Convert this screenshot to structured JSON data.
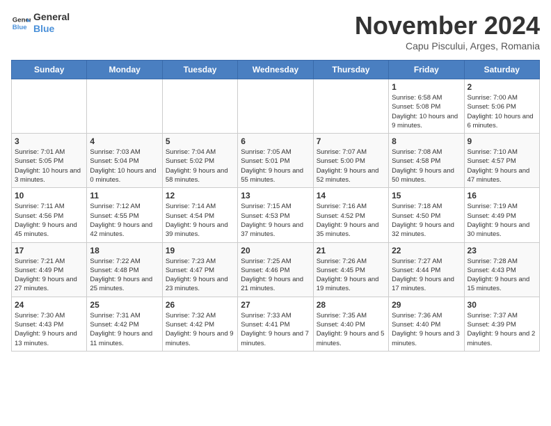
{
  "logo": {
    "line1": "General",
    "line2": "Blue"
  },
  "title": "November 2024",
  "subtitle": "Capu Piscului, Arges, Romania",
  "days_of_week": [
    "Sunday",
    "Monday",
    "Tuesday",
    "Wednesday",
    "Thursday",
    "Friday",
    "Saturday"
  ],
  "weeks": [
    [
      {
        "date": "",
        "info": ""
      },
      {
        "date": "",
        "info": ""
      },
      {
        "date": "",
        "info": ""
      },
      {
        "date": "",
        "info": ""
      },
      {
        "date": "",
        "info": ""
      },
      {
        "date": "1",
        "info": "Sunrise: 6:58 AM\nSunset: 5:08 PM\nDaylight: 10 hours and 9 minutes."
      },
      {
        "date": "2",
        "info": "Sunrise: 7:00 AM\nSunset: 5:06 PM\nDaylight: 10 hours and 6 minutes."
      }
    ],
    [
      {
        "date": "3",
        "info": "Sunrise: 7:01 AM\nSunset: 5:05 PM\nDaylight: 10 hours and 3 minutes."
      },
      {
        "date": "4",
        "info": "Sunrise: 7:03 AM\nSunset: 5:04 PM\nDaylight: 10 hours and 0 minutes."
      },
      {
        "date": "5",
        "info": "Sunrise: 7:04 AM\nSunset: 5:02 PM\nDaylight: 9 hours and 58 minutes."
      },
      {
        "date": "6",
        "info": "Sunrise: 7:05 AM\nSunset: 5:01 PM\nDaylight: 9 hours and 55 minutes."
      },
      {
        "date": "7",
        "info": "Sunrise: 7:07 AM\nSunset: 5:00 PM\nDaylight: 9 hours and 52 minutes."
      },
      {
        "date": "8",
        "info": "Sunrise: 7:08 AM\nSunset: 4:58 PM\nDaylight: 9 hours and 50 minutes."
      },
      {
        "date": "9",
        "info": "Sunrise: 7:10 AM\nSunset: 4:57 PM\nDaylight: 9 hours and 47 minutes."
      }
    ],
    [
      {
        "date": "10",
        "info": "Sunrise: 7:11 AM\nSunset: 4:56 PM\nDaylight: 9 hours and 45 minutes."
      },
      {
        "date": "11",
        "info": "Sunrise: 7:12 AM\nSunset: 4:55 PM\nDaylight: 9 hours and 42 minutes."
      },
      {
        "date": "12",
        "info": "Sunrise: 7:14 AM\nSunset: 4:54 PM\nDaylight: 9 hours and 39 minutes."
      },
      {
        "date": "13",
        "info": "Sunrise: 7:15 AM\nSunset: 4:53 PM\nDaylight: 9 hours and 37 minutes."
      },
      {
        "date": "14",
        "info": "Sunrise: 7:16 AM\nSunset: 4:52 PM\nDaylight: 9 hours and 35 minutes."
      },
      {
        "date": "15",
        "info": "Sunrise: 7:18 AM\nSunset: 4:50 PM\nDaylight: 9 hours and 32 minutes."
      },
      {
        "date": "16",
        "info": "Sunrise: 7:19 AM\nSunset: 4:49 PM\nDaylight: 9 hours and 30 minutes."
      }
    ],
    [
      {
        "date": "17",
        "info": "Sunrise: 7:21 AM\nSunset: 4:49 PM\nDaylight: 9 hours and 27 minutes."
      },
      {
        "date": "18",
        "info": "Sunrise: 7:22 AM\nSunset: 4:48 PM\nDaylight: 9 hours and 25 minutes."
      },
      {
        "date": "19",
        "info": "Sunrise: 7:23 AM\nSunset: 4:47 PM\nDaylight: 9 hours and 23 minutes."
      },
      {
        "date": "20",
        "info": "Sunrise: 7:25 AM\nSunset: 4:46 PM\nDaylight: 9 hours and 21 minutes."
      },
      {
        "date": "21",
        "info": "Sunrise: 7:26 AM\nSunset: 4:45 PM\nDaylight: 9 hours and 19 minutes."
      },
      {
        "date": "22",
        "info": "Sunrise: 7:27 AM\nSunset: 4:44 PM\nDaylight: 9 hours and 17 minutes."
      },
      {
        "date": "23",
        "info": "Sunrise: 7:28 AM\nSunset: 4:43 PM\nDaylight: 9 hours and 15 minutes."
      }
    ],
    [
      {
        "date": "24",
        "info": "Sunrise: 7:30 AM\nSunset: 4:43 PM\nDaylight: 9 hours and 13 minutes."
      },
      {
        "date": "25",
        "info": "Sunrise: 7:31 AM\nSunset: 4:42 PM\nDaylight: 9 hours and 11 minutes."
      },
      {
        "date": "26",
        "info": "Sunrise: 7:32 AM\nSunset: 4:42 PM\nDaylight: 9 hours and 9 minutes."
      },
      {
        "date": "27",
        "info": "Sunrise: 7:33 AM\nSunset: 4:41 PM\nDaylight: 9 hours and 7 minutes."
      },
      {
        "date": "28",
        "info": "Sunrise: 7:35 AM\nSunset: 4:40 PM\nDaylight: 9 hours and 5 minutes."
      },
      {
        "date": "29",
        "info": "Sunrise: 7:36 AM\nSunset: 4:40 PM\nDaylight: 9 hours and 3 minutes."
      },
      {
        "date": "30",
        "info": "Sunrise: 7:37 AM\nSunset: 4:39 PM\nDaylight: 9 hours and 2 minutes."
      }
    ]
  ]
}
